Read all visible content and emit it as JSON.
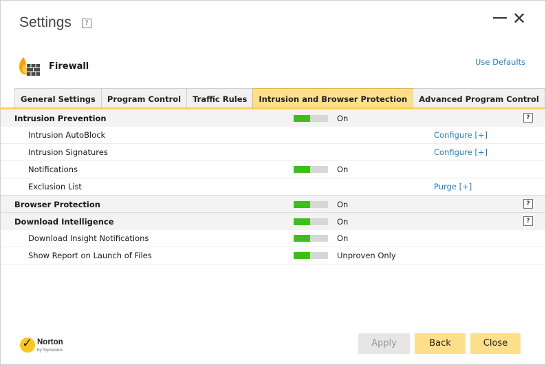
{
  "window": {
    "title": "Settings",
    "help": "?"
  },
  "section": {
    "icon": "firewall-icon",
    "label": "Firewall",
    "use_defaults": "Use Defaults"
  },
  "tabs": [
    {
      "label": "General Settings"
    },
    {
      "label": "Program Control"
    },
    {
      "label": "Traffic Rules"
    },
    {
      "label": "Intrusion and Browser Protection",
      "active": true
    },
    {
      "label": "Advanced Program Control"
    }
  ],
  "rows": [
    {
      "label": "Intrusion Prevention",
      "state": "On",
      "help": "?"
    },
    {
      "label": "Intrusion AutoBlock",
      "link": "Configure [+]"
    },
    {
      "label": "Intrusion Signatures",
      "link": "Configure [+]"
    },
    {
      "label": "Notifications",
      "state": "On"
    },
    {
      "label": "Exclusion List",
      "link": "Purge [+]"
    },
    {
      "label": "Browser Protection",
      "state": "On",
      "help": "?"
    },
    {
      "label": "Download Intelligence",
      "state": "On",
      "help": "?"
    },
    {
      "label": "Download Insight Notifications",
      "state": "On"
    },
    {
      "label": "Show Report on Launch of Files",
      "state": "Unproven Only"
    }
  ],
  "brand": {
    "name": "Norton",
    "sub": "by Symantec",
    "check": "✓"
  },
  "buttons": {
    "apply": "Apply",
    "back": "Back",
    "close": "Close"
  },
  "colors": {
    "accent": "#ffe08a",
    "toggle_on": "#3dbf1a",
    "link": "#2a7fc1"
  }
}
